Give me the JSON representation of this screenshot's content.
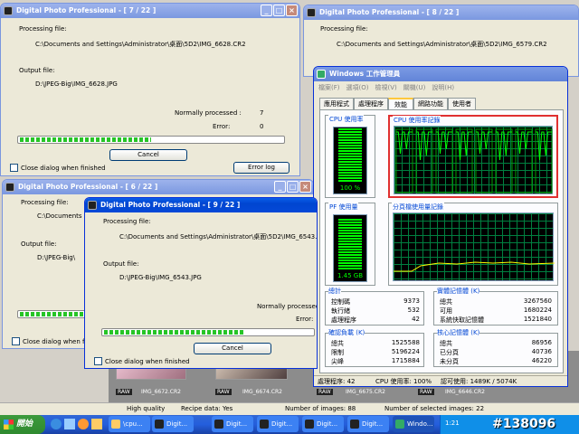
{
  "desktop": {
    "watermark": "#138096",
    "thumbnails": [
      {
        "label": "IMG_6672.CR2",
        "badge": "RAW"
      },
      {
        "label": "IMG_6674.CR2",
        "badge": "RAW"
      },
      {
        "label": "IMG_6675.CR2",
        "badge": "RAW"
      },
      {
        "label": "IMG_6646.CR2",
        "badge": "RAW"
      }
    ],
    "statusbar": {
      "quality": "High quality",
      "recipe": "Recipe data: Yes",
      "num_images": "Number of images: 88",
      "num_selected": "Number of selected images: 22"
    }
  },
  "dialog1": {
    "title": "Digital Photo Professional - [ 7 / 22 ]",
    "processing_label": "Processing file:",
    "processing_path": "C:\\Documents and Settings\\Administrator\\桌面\\5D2\\IMG_6628.CR2",
    "output_label": "Output file:",
    "output_path": "D:\\JPEG-Big\\IMG_6628.JPG",
    "normally_label": "Normally processed :",
    "normally_value": "7",
    "error_label": "Error:",
    "error_value": "0",
    "progress": 0.5,
    "cancel": "Cancel",
    "close_when_finished": "Close dialog when finished",
    "error_log": "Error log"
  },
  "dialog2": {
    "title": "Digital Photo Professional - [ 8 / 22 ]",
    "processing_label": "Processing file:",
    "processing_path": "C:\\Documents and Settings\\Administrator\\桌面\\5D2\\IMG_6579.CR2"
  },
  "dialog3": {
    "title": "Digital Photo Professional - [ 6 / 22 ]",
    "processing_label": "Processing file:",
    "processing_path": "C:\\Documents and",
    "output_label": "Output file:",
    "output_path": "D:\\JPEG-Big\\",
    "close_when_finished": "Close dialog when finishe"
  },
  "dialog4": {
    "title": "Digital Photo Professional - [ 9 / 22 ]",
    "processing_label": "Processing file:",
    "processing_path": "C:\\Documents and Settings\\Administrator\\桌面\\5D2\\IMG_6543.CR2",
    "output_label": "Output file:",
    "output_path": "D:\\JPEG-Big\\IMG_6543.JPG",
    "normally_label": "Normally processed :",
    "error_label": "Error:",
    "progress": 0.68,
    "cancel": "Cancel",
    "close_when_finished": "Close dialog when finished"
  },
  "taskmgr": {
    "title": "Windows 工作管理員",
    "menu": [
      "檔案(F)",
      "選項(O)",
      "檢視(V)",
      "關機(U)",
      "說明(H)"
    ],
    "tabs": [
      "應用程式",
      "處理程序",
      "效能",
      "網路功能",
      "使用者"
    ],
    "active_tab": 2,
    "cpu_usage_label": "CPU 使用率",
    "cpu_usage_value": "100 %",
    "cpu_usage_level": 1.0,
    "cpu_history_label": "CPU 使用率記錄",
    "pf_usage_label": "PF 使用量",
    "pf_usage_value": "1.45 GB",
    "pf_usage_level": 0.95,
    "pf_history_label": "分頁檔使用量記錄",
    "totals": {
      "title": "總計",
      "rows": [
        {
          "label": "控制碼",
          "value": "9373"
        },
        {
          "label": "執行緒",
          "value": "532"
        },
        {
          "label": "處理程序",
          "value": "42"
        }
      ]
    },
    "physical": {
      "title": "實體記憶體 (K)",
      "rows": [
        {
          "label": "總共",
          "value": "3267560"
        },
        {
          "label": "可用",
          "value": "1680224"
        },
        {
          "label": "系統快取記憶體",
          "value": "1521840"
        }
      ]
    },
    "commit": {
      "title": "確認負載 (K)",
      "rows": [
        {
          "label": "總共",
          "value": "1525588"
        },
        {
          "label": "限制",
          "value": "5196224"
        },
        {
          "label": "尖峰",
          "value": "1715884"
        }
      ]
    },
    "kernel": {
      "title": "核心記憶體 (K)",
      "rows": [
        {
          "label": "總共",
          "value": "86956"
        },
        {
          "label": "已分頁",
          "value": "40736"
        },
        {
          "label": "未分頁",
          "value": "46220"
        }
      ]
    },
    "status": {
      "processes": "處理程序: 42",
      "cpu": "CPU 使用率: 100%",
      "commit": "認可使用: 1489K / 5074K"
    }
  },
  "taskbar": {
    "start": "開始",
    "items": [
      {
        "label": "\\cpu..."
      },
      {
        "label": "Digit..."
      },
      {
        "label": "Digit..."
      },
      {
        "label": "Digit..."
      },
      {
        "label": "Digit..."
      },
      {
        "label": "Digit..."
      },
      {
        "label": "Windo..."
      }
    ],
    "clock": "1:21"
  },
  "colors": {
    "accent": "#0054e3",
    "highlight_box": "#e03030",
    "graph_green": "#00ff00"
  }
}
